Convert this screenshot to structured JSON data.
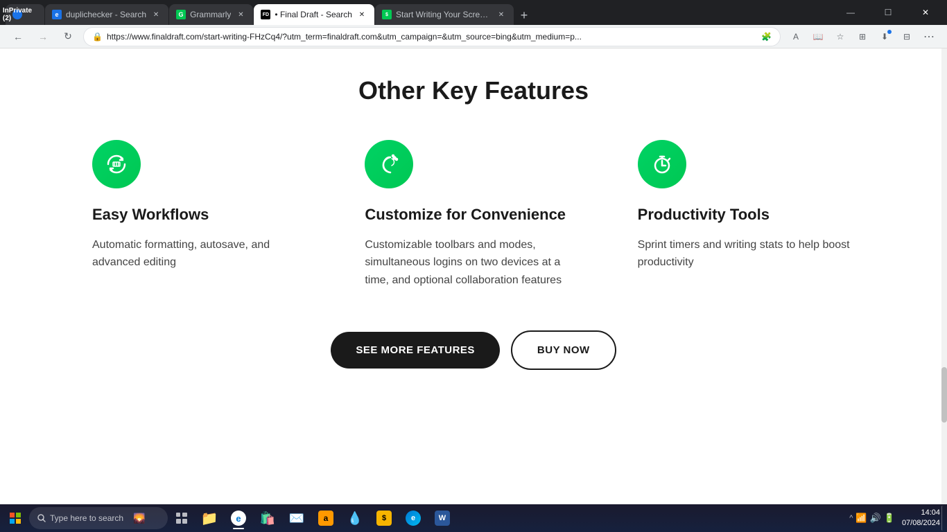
{
  "browser": {
    "tabs": [
      {
        "id": "tab1",
        "title": "InPrivate (2)",
        "favicon": "inprivate",
        "active": false,
        "inprivate": true
      },
      {
        "id": "tab2",
        "title": "duplichecker - Search",
        "favicon": "edge",
        "active": false
      },
      {
        "id": "tab3",
        "title": "Grammarly",
        "favicon": "grammarly",
        "active": false
      },
      {
        "id": "tab4",
        "title": "• Final Draft - Search",
        "favicon": "finaldraft",
        "active": true
      },
      {
        "id": "tab5",
        "title": "Start Writing Your Screenplay wi...",
        "favicon": "finaldraft2",
        "active": false
      }
    ],
    "url": "https://www.finaldraft.com/start-writing-FHzCq4/?utm_term=finaldraft.com&utm_campaign=&utm_source=bing&utm_medium=p...",
    "window_controls": {
      "minimize": "—",
      "maximize": "☐",
      "close": "✕"
    }
  },
  "page": {
    "title": "Other Key Features",
    "features": [
      {
        "id": "easy-workflows",
        "icon": "sync",
        "title": "Easy Workflows",
        "description": "Automatic formatting, autosave, and advanced editing"
      },
      {
        "id": "customize",
        "icon": "moon",
        "title": "Customize for Convenience",
        "description": "Customizable toolbars and modes, simultaneous logins on two devices at a time, and optional collaboration features"
      },
      {
        "id": "productivity",
        "icon": "timer",
        "title": "Productivity Tools",
        "description": "Sprint timers and writing stats to help boost productivity"
      }
    ],
    "buttons": {
      "see_more": "SEE MORE FEATURES",
      "buy_now": "BUY NOW"
    }
  },
  "taskbar": {
    "search_placeholder": "Type here to search",
    "clock": {
      "time": "14:04",
      "date": "07/08/2024"
    },
    "apps": [
      "file-explorer",
      "edge-browser",
      "microsoft-store",
      "mail",
      "amazon",
      "dropbox",
      "sketch",
      "edge2",
      "word"
    ]
  }
}
